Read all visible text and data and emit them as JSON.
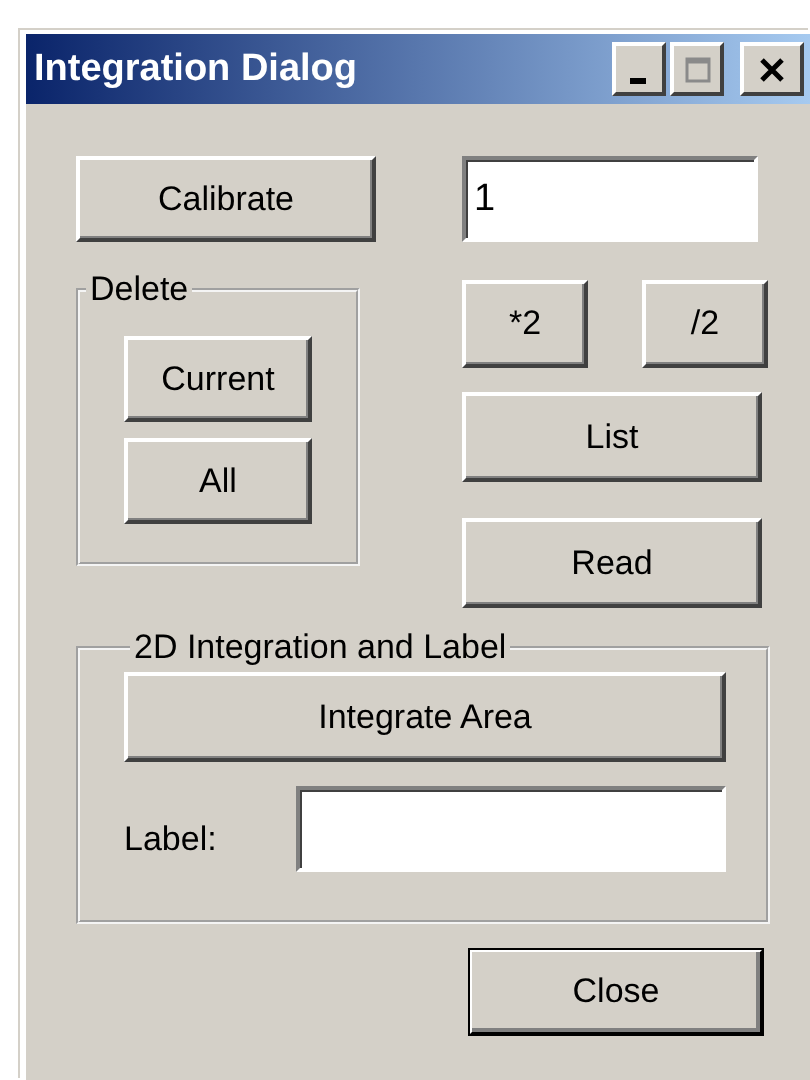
{
  "window": {
    "title": "Integration Dialog"
  },
  "title_buttons": [
    {
      "kind": "minimize"
    },
    {
      "kind": "maximize"
    },
    {
      "kind": "close"
    }
  ],
  "calibrate_button": "Calibrate",
  "value_field": {
    "value": "1"
  },
  "delete_group": {
    "title": "Delete",
    "buttons": [
      "Current",
      "All"
    ]
  },
  "scale_buttons": [
    "*2",
    "/2"
  ],
  "action_buttons": [
    "List",
    "Read"
  ],
  "integration_group": {
    "title": "2D Integration and Label",
    "button": "Integrate Area",
    "label_field": {
      "label": "Label:"
    }
  },
  "close_button": {
    "label": "Close",
    "default": true
  }
}
